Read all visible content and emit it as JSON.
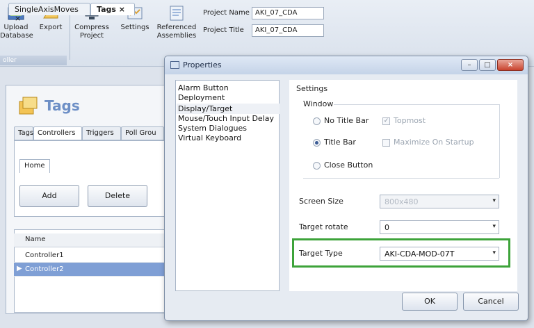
{
  "ribbon": {
    "upload_label_l1": "Upload",
    "upload_label_l2": "Database",
    "export_label": "Export",
    "compress_label_l1": "Compress",
    "compress_label_l2": "Project",
    "settings_label": "Settings",
    "ref_label_l1": "Referenced",
    "ref_label_l2": "Assemblies",
    "group_label": "oller",
    "project_name_label": "Project Name",
    "project_name_value": "AKI_07_CDA",
    "project_title_label": "Project Title",
    "project_title_value": "AKI_07_CDA"
  },
  "doc_tabs": [
    {
      "label": "SingleAxisMoves"
    },
    {
      "label": "Tags"
    }
  ],
  "tags_page": {
    "title": "Tags",
    "subtabs": [
      "Tags",
      "Controllers",
      "Triggers",
      "Poll Grou"
    ],
    "home_tab": "Home",
    "add_label": "Add",
    "delete_label": "Delete",
    "grid_header": "Name",
    "rows": [
      "Controller1",
      "Controller2"
    ]
  },
  "dialog": {
    "title": "Properties",
    "nav_items": [
      "Alarm Button",
      "Deployment",
      "Display/Target",
      "Mouse/Touch Input Delay",
      "System Dialogues",
      "Virtual Keyboard"
    ],
    "settings_heading": "Settings",
    "window_group": "Window",
    "opt_no_title": "No Title Bar",
    "opt_title": "Title Bar",
    "opt_close": "Close Button",
    "chk_topmost": "Topmost",
    "chk_maximize": "Maximize On Startup",
    "screen_size_label": "Screen Size",
    "screen_size_value": "800x480",
    "target_rotate_label": "Target rotate",
    "target_rotate_value": "0",
    "target_type_label": "Target Type",
    "target_type_value": "AKI-CDA-MOD-07T",
    "ok_label": "OK",
    "cancel_label": "Cancel"
  },
  "colors": {
    "highlight_box": "#3da33a",
    "selected_row": "#7f9fd5",
    "tags_title": "#6d8fc6"
  }
}
